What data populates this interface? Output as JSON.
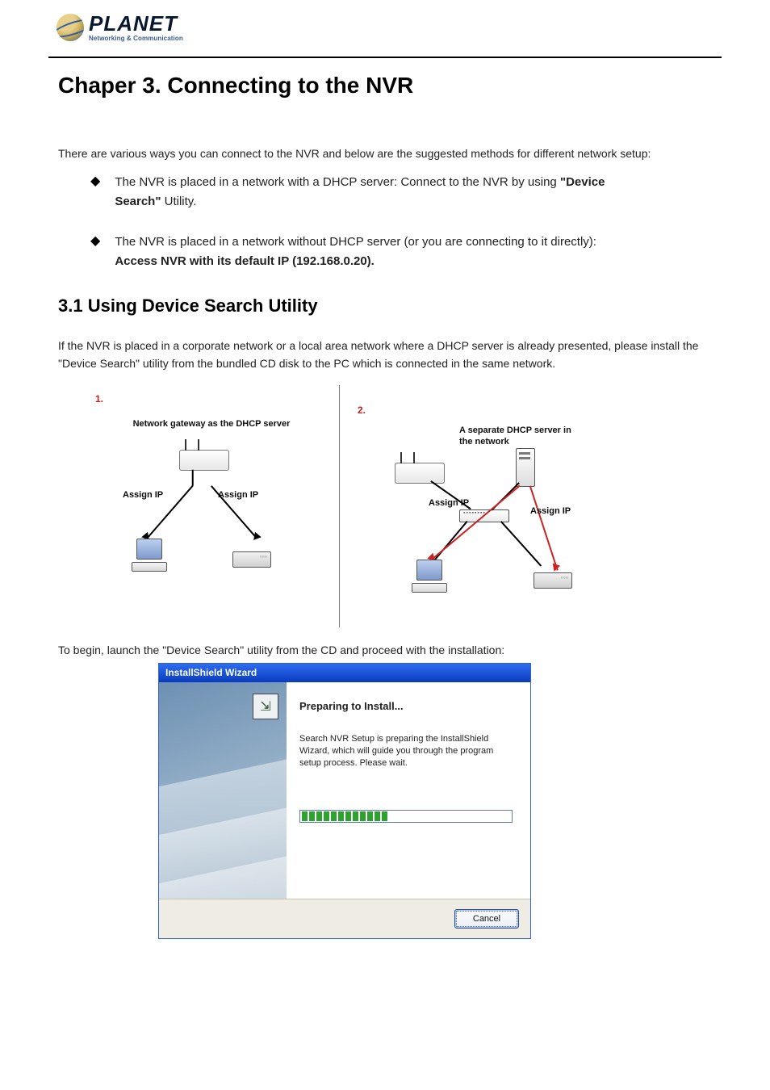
{
  "logo": {
    "word": "PLANET",
    "tagline": "Networking & Communication"
  },
  "chapter_title": "Chaper 3. Connecting to the NVR",
  "intro": "There are various ways you can connect to the NVR and below are the suggested methods for different network setup:",
  "bullets": [
    {
      "pre": "The NVR is placed in a network with a DHCP server: Connect to the NVR by using ",
      "bold": "\"Device Search\"",
      "post": " Utility."
    },
    {
      "pre": "The NVR is placed in a network without DHCP server (or you are connecting to it directly): ",
      "bold": "Access NVR with its default IP (192.168.0.20).",
      "post": ""
    }
  ],
  "section_title": "3.1 Using Device Search Utility",
  "section_body": "If the NVR is placed in a corporate network or a local area network where a DHCP server is already presented, please install the \"Device Search\" utility from the bundled CD disk to the PC which is connected in the same network.",
  "diagram1": {
    "num": "1.",
    "caption": "Network gateway as the DHCP server",
    "assign": "Assign IP"
  },
  "diagram2": {
    "num": "2.",
    "caption": "A separate DHCP server in the network",
    "assign": "Assign IP"
  },
  "diag_caption": "To begin, launch the \"Device Search\" utility from the CD and proceed with the installation:",
  "installer": {
    "title": "InstallShield Wizard",
    "heading": "Preparing to Install...",
    "body": "Search NVR Setup is preparing the InstallShield Wizard, which will guide you through the program setup process. Please wait.",
    "cancel": "Cancel",
    "progress_segments": 12
  }
}
